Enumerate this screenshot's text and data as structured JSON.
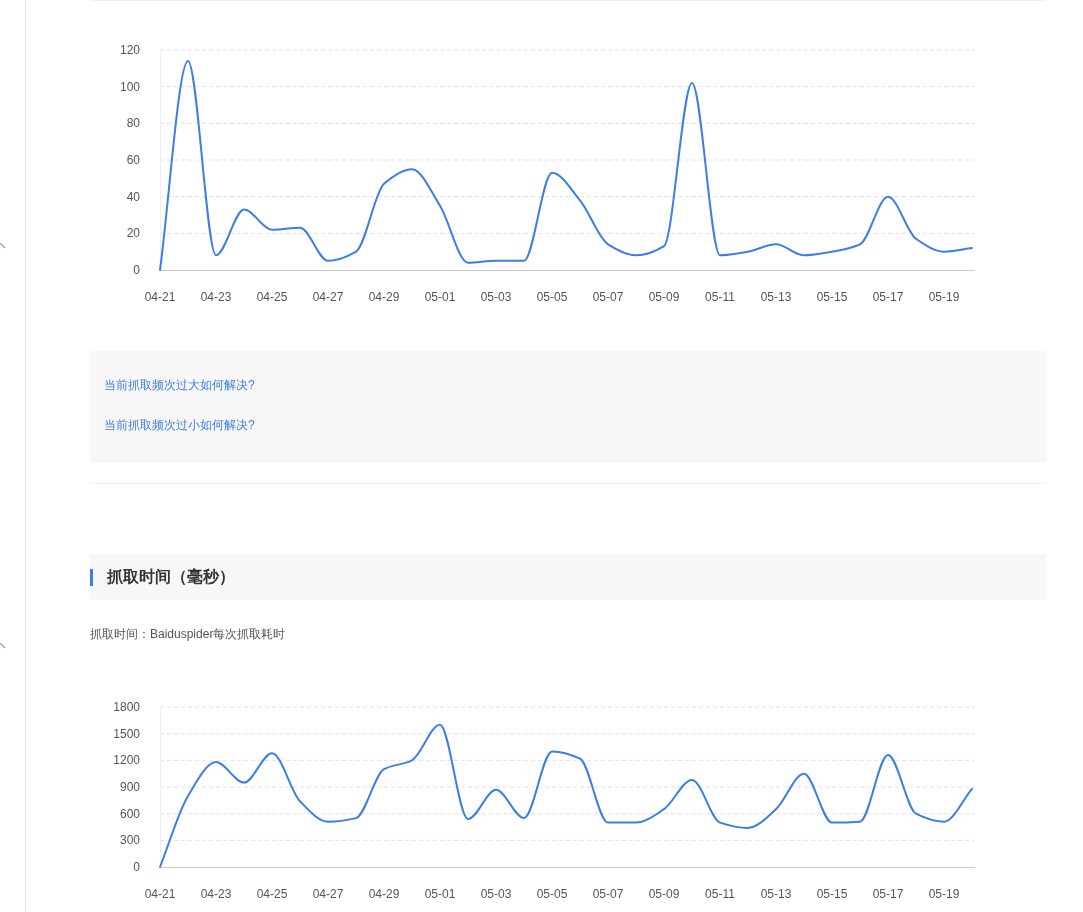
{
  "crawl_frequency": {
    "chart_data": {
      "type": "line",
      "categories": [
        "04-21",
        null,
        "04-23",
        null,
        "04-25",
        null,
        "04-27",
        null,
        "04-29",
        null,
        "05-01",
        null,
        "05-03",
        null,
        "05-05",
        null,
        "05-07",
        null,
        "05-09",
        null,
        "05-11",
        null,
        "05-13",
        null,
        "05-15",
        null,
        "05-17",
        null,
        "05-19",
        null
      ],
      "ylim": [
        0,
        120
      ],
      "yticks": [
        0,
        20,
        40,
        60,
        80,
        100,
        120
      ],
      "grid": true,
      "series": [
        {
          "color": "#3b7ee8",
          "values": [
            0,
            114,
            8,
            33,
            22,
            23,
            5,
            10,
            47,
            55,
            35,
            4,
            5,
            5,
            53,
            38,
            14,
            8,
            13,
            102,
            8,
            10,
            14,
            8,
            10,
            14,
            40,
            17,
            10,
            12
          ]
        }
      ]
    }
  },
  "help_box": {
    "links": [
      "当前抓取频次过大如何解决?",
      "当前抓取频次过小如何解决?"
    ]
  },
  "crawl_time": {
    "title": "抓取时间（毫秒）",
    "description": "抓取时间：Baiduspider每次抓取耗时",
    "chart_data": {
      "type": "line",
      "categories": [
        "04-21",
        null,
        "04-23",
        null,
        "04-25",
        null,
        "04-27",
        null,
        "04-29",
        null,
        "05-01",
        null,
        "05-03",
        null,
        "05-05",
        null,
        "05-07",
        null,
        "05-09",
        null,
        "05-11",
        null,
        "05-13",
        null,
        "05-15",
        null,
        "05-17",
        null,
        "05-19",
        null
      ],
      "ylim": [
        0,
        1800
      ],
      "yticks": [
        0,
        300,
        600,
        900,
        1200,
        1500,
        1800
      ],
      "grid": true,
      "series": [
        {
          "color": "#3b7ee8",
          "values": [
            0,
            800,
            1180,
            950,
            1280,
            740,
            510,
            550,
            1100,
            1200,
            1600,
            540,
            870,
            550,
            1300,
            1220,
            500,
            500,
            650,
            980,
            500,
            440,
            650,
            1050,
            500,
            510,
            1260,
            600,
            510,
            880
          ]
        }
      ]
    }
  }
}
